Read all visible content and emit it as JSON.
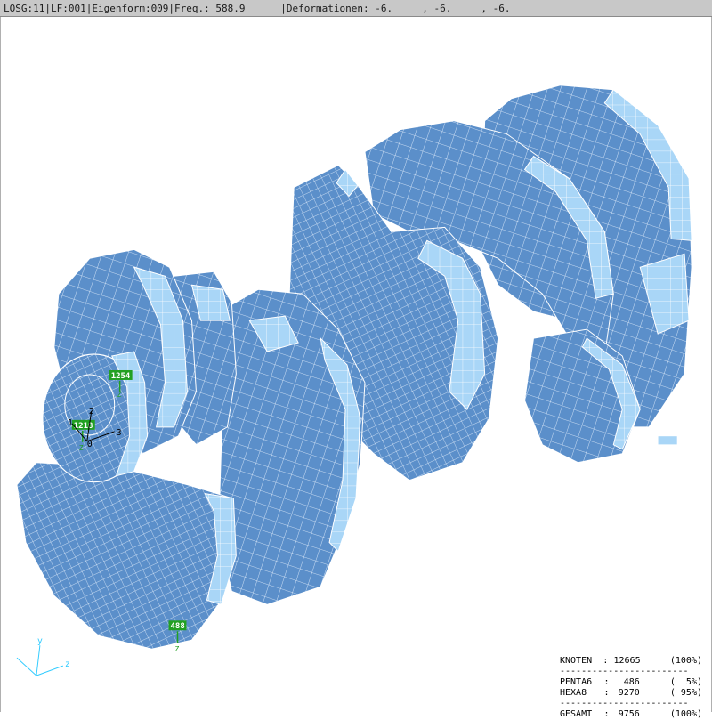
{
  "status_bar": {
    "text": "LOSG:11|LF:001|Eigenform:009|Freq.: 588.9      |Deformationen: -6.     , -6.     , -6."
  },
  "node_labels": [
    "1254",
    "1218",
    "488"
  ],
  "node_marker_text": "Z",
  "axis_labels": {
    "a1": "1",
    "a2": "2",
    "a3": "3",
    "origin": "0"
  },
  "triad": {
    "y": "y",
    "z": "z"
  },
  "stats": {
    "rows": [
      {
        "label": "KNOTEN",
        "value": "12665",
        "pct": "(100%)"
      },
      {
        "label": "PENTA6",
        "value": "486",
        "pct": "(  5%)"
      },
      {
        "label": "HEXA8",
        "value": "9270",
        "pct": "( 95%)"
      },
      {
        "label": "GESAMT",
        "value": "9756",
        "pct": "(100%)"
      }
    ]
  },
  "colors": {
    "mesh_face": "#5b8fca",
    "mesh_light": "#a9d6f7",
    "mesh_line": "#ffffff",
    "node_tag": "#22a022",
    "status_bg": "#c8c8c8"
  }
}
